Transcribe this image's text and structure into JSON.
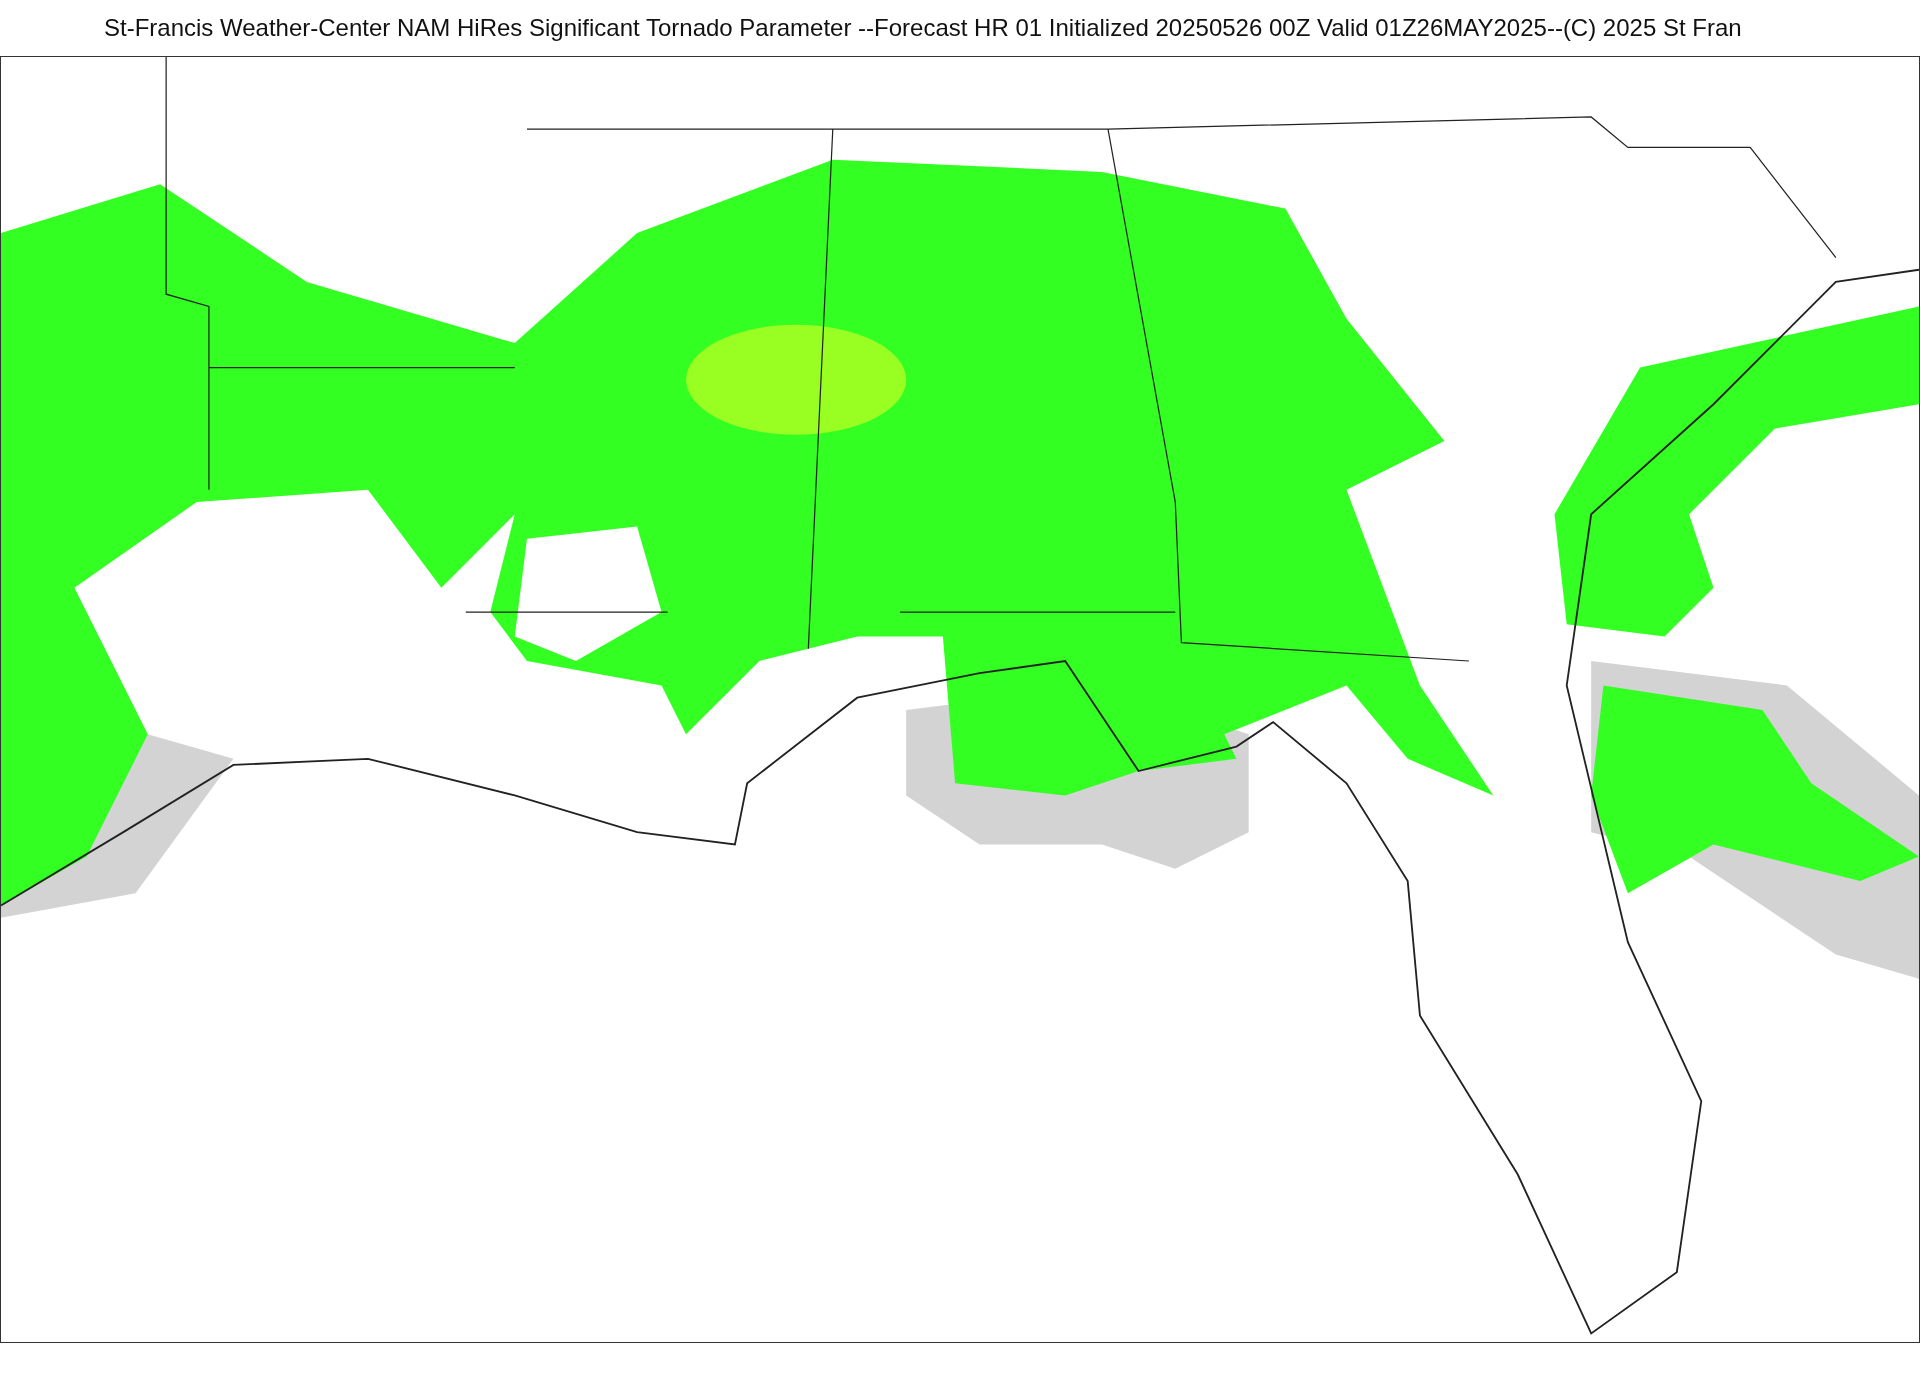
{
  "title": "St-Francis Weather-Center NAM HiRes Significant Tornado Parameter --Forecast HR 01 Initialized 20250526 00Z Valid 01Z26MAY2025--(C) 2025 St Fran"
}
